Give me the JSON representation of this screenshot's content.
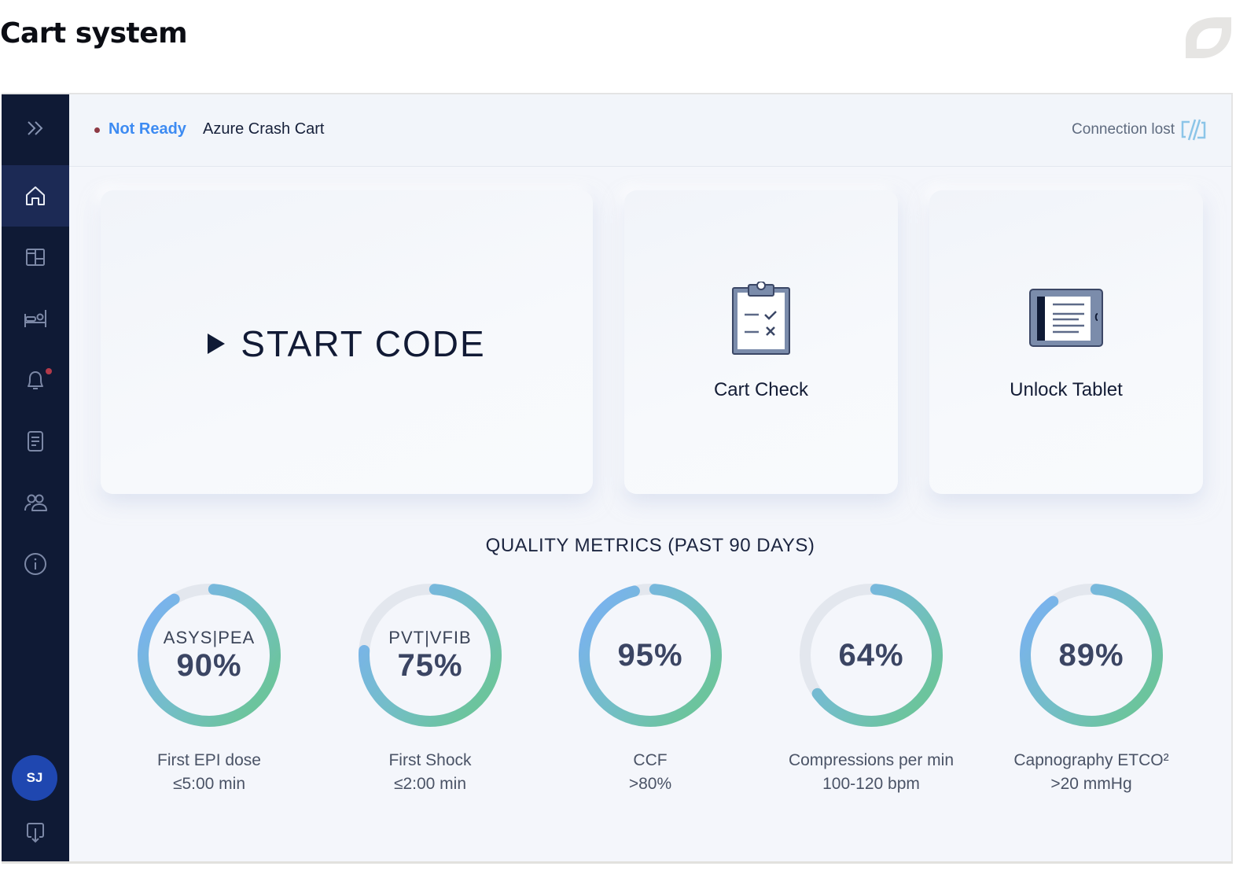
{
  "page": {
    "title": "Cart system"
  },
  "brand": {
    "icon": "leaf-logo-icon"
  },
  "sidebar": {
    "items": [
      {
        "name": "expand",
        "icon": "chevrons-right-icon",
        "active": false
      },
      {
        "name": "home",
        "icon": "home-icon",
        "active": true
      },
      {
        "name": "layout",
        "icon": "layout-grid-icon",
        "active": false
      },
      {
        "name": "beds",
        "icon": "bed-icon",
        "active": false
      },
      {
        "name": "notifications",
        "icon": "bell-icon",
        "active": false,
        "badge": true
      },
      {
        "name": "reports",
        "icon": "document-icon",
        "active": false
      },
      {
        "name": "team",
        "icon": "users-icon",
        "active": false
      },
      {
        "name": "info",
        "icon": "info-icon",
        "active": false
      }
    ],
    "avatar_initials": "SJ",
    "logout_icon": "logout-icon"
  },
  "topbar": {
    "status": "Not Ready",
    "cart_name": "Azure Crash Cart",
    "connection": "Connection lost",
    "connection_icon": "link-broken-icon"
  },
  "actions": {
    "start_code": "START CODE",
    "cart_check": "Cart Check",
    "unlock_tablet": "Unlock Tablet"
  },
  "metrics": {
    "title": "QUALITY METRICS (PAST 90 DAYS)",
    "items": [
      {
        "sub": "ASYS|PEA",
        "value": "90%",
        "percent": 90,
        "label": "First EPI dose",
        "target": "≤5:00 min"
      },
      {
        "sub": "PVT|VFIB",
        "value": "75%",
        "percent": 75,
        "label": "First Shock",
        "target": "≤2:00 min"
      },
      {
        "sub": "",
        "value": "95%",
        "percent": 95,
        "label": "CCF",
        "target": ">80%"
      },
      {
        "sub": "",
        "value": "64%",
        "percent": 64,
        "label": "Compressions per min",
        "target": "100-120 bpm"
      },
      {
        "sub": "",
        "value": "89%",
        "percent": 89,
        "label": "Capnography ETCO²",
        "target": ">20 mmHg"
      }
    ]
  },
  "colors": {
    "sidebar_bg": "#0f1a35",
    "sidebar_active": "#1c2a55",
    "status_text": "#3d8bf2",
    "status_dot": "#8e3a44",
    "ring_track": "#e3e7ee",
    "ring_start": "#7ab2f0",
    "ring_mid": "#73bec6",
    "ring_end": "#6cc49d"
  }
}
